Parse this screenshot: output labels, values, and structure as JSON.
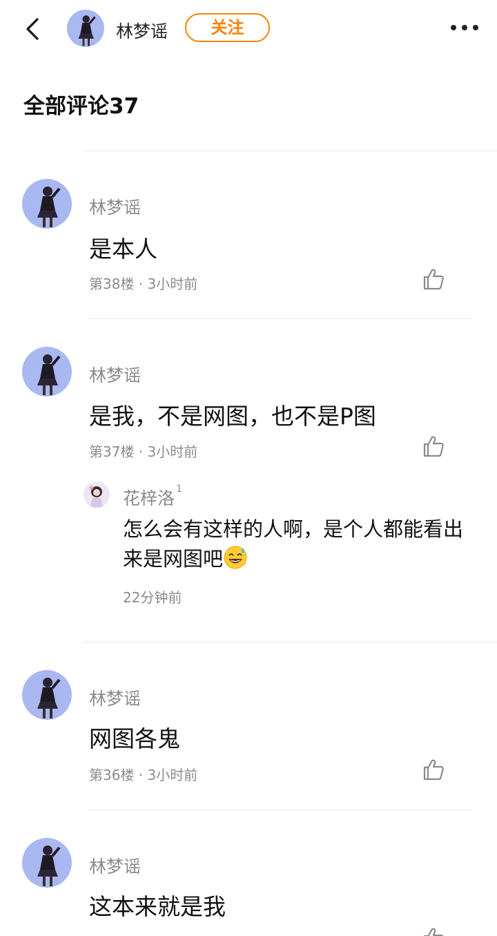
{
  "header": {
    "username": "林梦谣",
    "follow_label": "关注"
  },
  "section": {
    "title": "全部评论37"
  },
  "comments": [
    {
      "name": "林梦谣",
      "text": "是本人",
      "meta": "第38楼 · 3小时前"
    },
    {
      "name": "林梦谣",
      "text": "是我，不是网图，也不是P图",
      "meta": "第37楼 · 3小时前",
      "reply": {
        "name": "花梓洛",
        "level": "1",
        "text": "怎么会有这样的人啊，是个人都能看出来是网图吧",
        "meta": "22分钟前"
      }
    },
    {
      "name": "林梦谣",
      "text": "网图各鬼",
      "meta": "第36楼 · 3小时前"
    },
    {
      "name": "林梦谣",
      "text": "这本来就是我"
    }
  ],
  "icons": {
    "back": "chevron-left-icon",
    "more": "more-dots-icon",
    "like": "thumbs-up-icon",
    "emoji": "sweat-smile-emoji-icon"
  },
  "colors": {
    "accent": "#ff8200",
    "avatar_bg": "#a9b8f0"
  }
}
